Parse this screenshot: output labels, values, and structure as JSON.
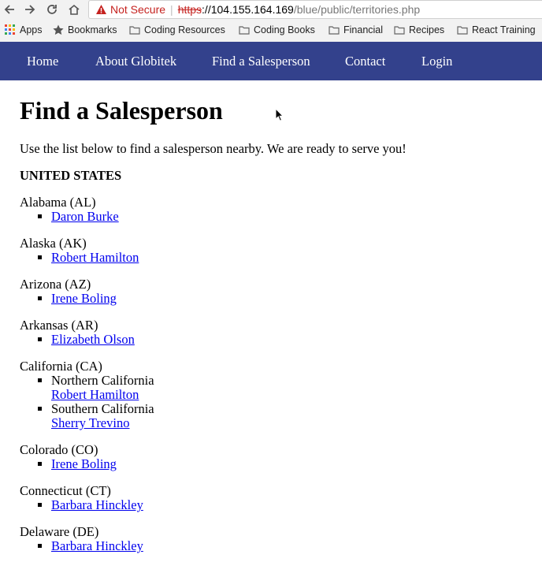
{
  "browser": {
    "security_label": "Not Secure",
    "url_scheme": "https",
    "url_sep": "://",
    "url_host": "104.155.164.169",
    "url_path": "/blue/public/territories.php",
    "bookmarks": [
      {
        "label": "Apps",
        "icon": "apps-grid-icon"
      },
      {
        "label": "Bookmarks",
        "icon": "star-icon"
      },
      {
        "label": "Coding Resources",
        "icon": "folder-icon"
      },
      {
        "label": "Coding Books",
        "icon": "folder-icon"
      },
      {
        "label": "Financial",
        "icon": "folder-icon"
      },
      {
        "label": "Recipes",
        "icon": "folder-icon"
      },
      {
        "label": "React Training",
        "icon": "folder-icon"
      }
    ]
  },
  "nav": {
    "items": [
      "Home",
      "About Globitek",
      "Find a Salesperson",
      "Contact",
      "Login"
    ],
    "background": "#33418c"
  },
  "page": {
    "title": "Find a Salesperson",
    "intro": "Use the list below to find a salesperson nearby. We are ready to serve you!",
    "country": "UNITED STATES",
    "states": [
      {
        "name": "Alabama (AL)",
        "entries": [
          {
            "region": "",
            "person": "Daron Burke"
          }
        ]
      },
      {
        "name": "Alaska (AK)",
        "entries": [
          {
            "region": "",
            "person": "Robert Hamilton"
          }
        ]
      },
      {
        "name": "Arizona (AZ)",
        "entries": [
          {
            "region": "",
            "person": "Irene Boling"
          }
        ]
      },
      {
        "name": "Arkansas (AR)",
        "entries": [
          {
            "region": "",
            "person": "Elizabeth Olson"
          }
        ]
      },
      {
        "name": "California (CA)",
        "entries": [
          {
            "region": "Northern California",
            "person": "Robert Hamilton"
          },
          {
            "region": "Southern California",
            "person": "Sherry Trevino"
          }
        ]
      },
      {
        "name": "Colorado (CO)",
        "entries": [
          {
            "region": "",
            "person": "Irene Boling"
          }
        ]
      },
      {
        "name": "Connecticut (CT)",
        "entries": [
          {
            "region": "",
            "person": "Barbara Hinckley"
          }
        ]
      },
      {
        "name": "Delaware (DE)",
        "entries": [
          {
            "region": "",
            "person": "Barbara Hinckley"
          }
        ]
      }
    ],
    "link_color": "#0000ee"
  }
}
